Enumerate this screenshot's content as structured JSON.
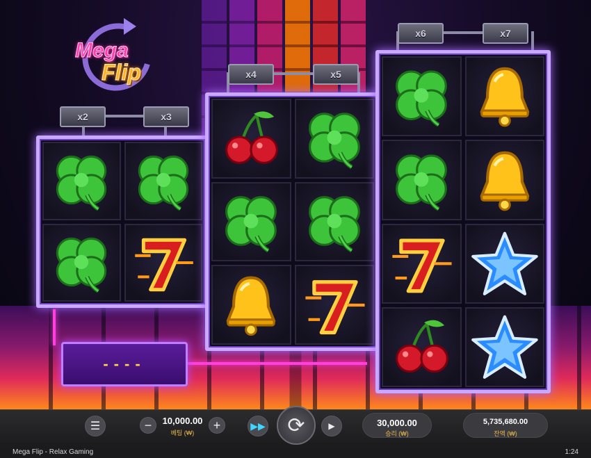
{
  "game": {
    "logo_line1": "Mega",
    "logo_line2": "Flip"
  },
  "multipliers": {
    "reel1": [
      "x2",
      "x3"
    ],
    "reel2": [
      "x4",
      "x5"
    ],
    "reel3": [
      "x6",
      "x7"
    ]
  },
  "reels": {
    "reel1": [
      "clover",
      "clover",
      "clover",
      "seven"
    ],
    "reel2": [
      "cherry",
      "clover",
      "clover",
      "clover",
      "bell",
      "seven"
    ],
    "reel3": [
      "clover",
      "bell",
      "clover",
      "bell",
      "seven",
      "star",
      "cherry",
      "star"
    ]
  },
  "win_display": "----",
  "toolbar": {
    "bet_value": "10,000.00",
    "bet_label": "베팅 (₩)",
    "win_value": "30,000.00",
    "win_label": "승리 (₩)",
    "balance_value": "5,735,680.00",
    "balance_label": "잔액 (₩)",
    "menu_icon": "menu-icon",
    "spin_icon": "refresh-icon"
  },
  "footer": {
    "title": "Mega Flip - Relax Gaming",
    "time": "1:24"
  }
}
